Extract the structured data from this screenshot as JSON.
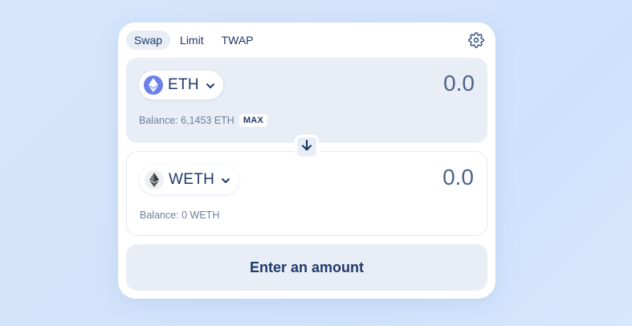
{
  "tabs": [
    {
      "label": "Swap",
      "active": true
    },
    {
      "label": "Limit",
      "active": false
    },
    {
      "label": "TWAP",
      "active": false
    }
  ],
  "icons": {
    "settings": "gear-icon",
    "switch": "arrow-down-icon",
    "dropdown": "chevron-down-icon",
    "eth_logo": "ethereum-icon",
    "weth_logo": "weth-icon"
  },
  "from": {
    "token_symbol": "ETH",
    "amount_placeholder": "0.0",
    "balance_label": "Balance: 6,1453 ETH",
    "max_label": "MAX"
  },
  "to": {
    "token_symbol": "WETH",
    "amount_placeholder": "0.0",
    "balance_label": "Balance: 0 WETH"
  },
  "action_button": {
    "label": "Enter an amount"
  },
  "colors": {
    "primary_text": "#1f3a6b",
    "panel_bg": "#e9eef6",
    "eth_logo": "#6b80e8",
    "page_bg": "#d3e3fb"
  }
}
